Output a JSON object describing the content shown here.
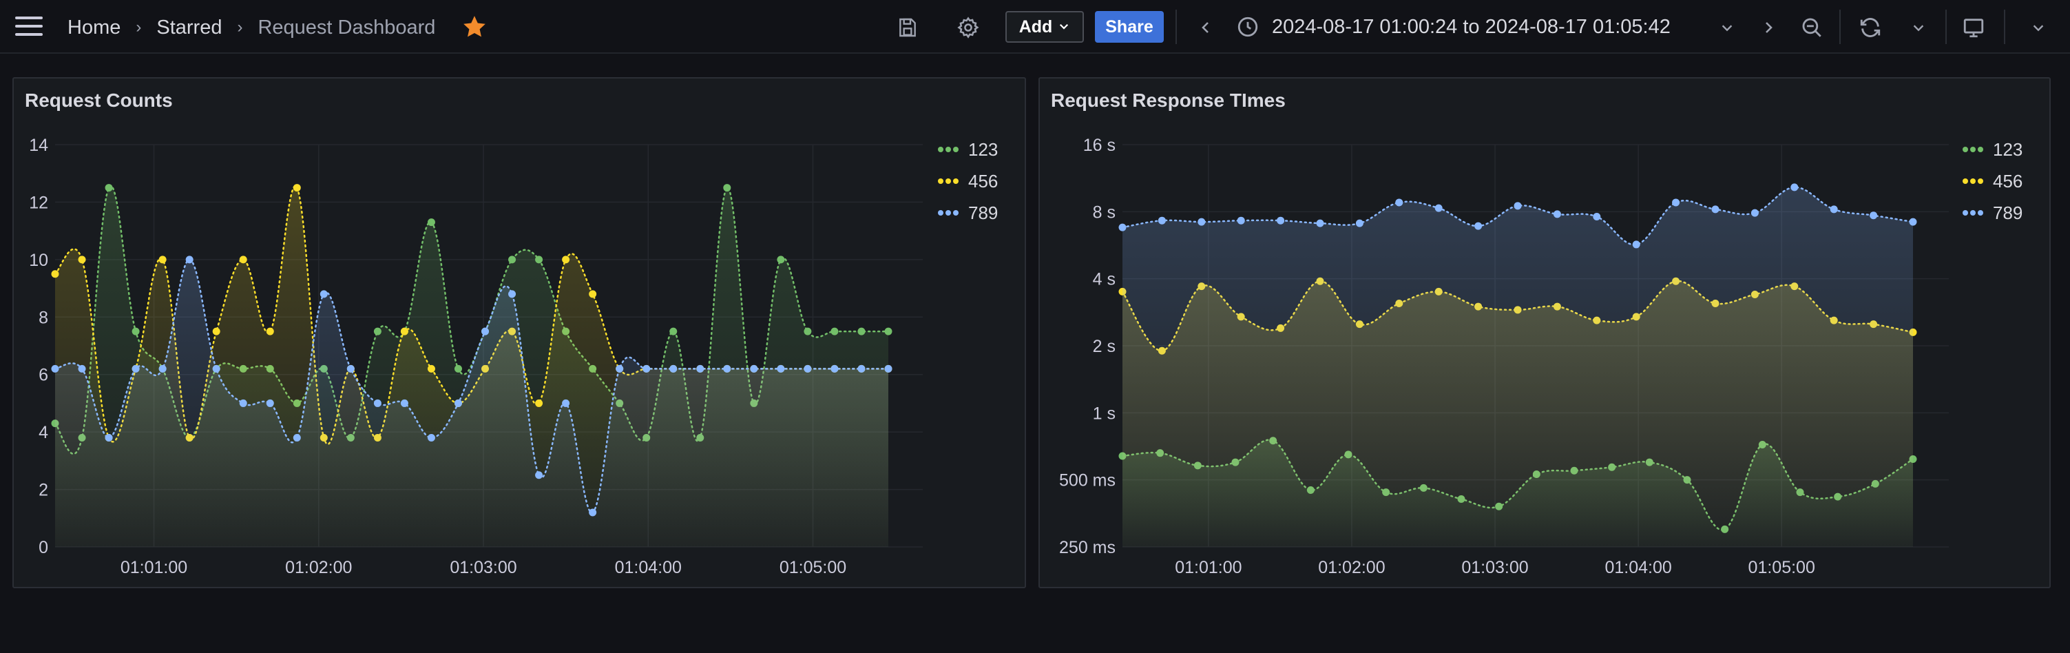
{
  "nav": {
    "menu_icon": "hamburger-menu-icon",
    "breadcrumbs": [
      "Home",
      "Starred",
      "Request Dashboard"
    ],
    "star_icon": "star-icon",
    "star_color": "#f28b2c"
  },
  "toolbar": {
    "save_icon": "save-icon",
    "settings_icon": "gear-icon",
    "add_label": "Add",
    "share_label": "Share",
    "time_range": "2024-08-17 01:00:24 to 2024-08-17 01:05:42",
    "zoom_out_icon": "zoom-out-icon",
    "refresh_icon": "refresh-icon",
    "tv_icon": "tv-mode-icon",
    "accent": "#3d71d9"
  },
  "panels": [
    {
      "title": "Request Counts",
      "legend": [
        "123",
        "456",
        "789"
      ]
    },
    {
      "title": "Request Response TImes",
      "legend": [
        "123",
        "456",
        "789"
      ]
    }
  ],
  "series_colors": {
    "123": "#73bf69",
    "456": "#fade2a",
    "789": "#8ab8ff"
  },
  "chart_data": [
    {
      "type": "line",
      "title": "Request Counts",
      "x": [
        "01:00:24",
        "01:00:30",
        "01:00:40",
        "01:00:50",
        "01:01:00",
        "01:01:10",
        "01:01:20",
        "01:01:30",
        "01:01:40",
        "01:01:50",
        "01:02:00",
        "01:02:10",
        "01:02:20",
        "01:02:30",
        "01:02:40",
        "01:02:50",
        "01:03:00",
        "01:03:10",
        "01:03:20",
        "01:03:30",
        "01:03:40",
        "01:03:50",
        "01:04:00",
        "01:04:10",
        "01:04:20",
        "01:04:30",
        "01:04:40",
        "01:04:50",
        "01:05:00",
        "01:05:10",
        "01:05:20",
        "01:05:30"
      ],
      "x_ticks": [
        "01:01:00",
        "01:02:00",
        "01:03:00",
        "01:04:00",
        "01:05:00"
      ],
      "y_ticks": [
        0,
        2,
        4,
        6,
        8,
        10,
        12,
        14
      ],
      "ylim": [
        0,
        14
      ],
      "series": [
        {
          "name": "123",
          "values": [
            4.3,
            3.8,
            12.5,
            7.5,
            6.2,
            3.8,
            6.2,
            6.2,
            6.2,
            5.0,
            6.2,
            3.8,
            7.5,
            7.5,
            11.3,
            6.2,
            7.5,
            10.0,
            10.0,
            7.5,
            6.2,
            5.0,
            3.8,
            7.5,
            3.8,
            12.5,
            5.0,
            10.0,
            7.5,
            7.5,
            7.5,
            7.5
          ]
        },
        {
          "name": "456",
          "values": [
            9.5,
            10.0,
            3.8,
            6.2,
            10.0,
            3.8,
            7.5,
            10.0,
            7.5,
            12.5,
            3.8,
            6.2,
            3.8,
            7.5,
            6.2,
            5.0,
            6.2,
            7.5,
            5.0,
            10.0,
            8.8,
            6.2,
            6.2,
            6.2,
            6.2,
            6.2,
            6.2,
            6.2,
            6.2,
            6.2,
            6.2,
            6.2
          ]
        },
        {
          "name": "789",
          "values": [
            6.2,
            6.2,
            3.8,
            6.2,
            6.2,
            10.0,
            6.2,
            5.0,
            5.0,
            3.8,
            8.8,
            6.2,
            5.0,
            5.0,
            3.8,
            5.0,
            7.5,
            8.8,
            2.5,
            5.0,
            1.2,
            6.2,
            6.2,
            6.2,
            6.2,
            6.2,
            6.2,
            6.2,
            6.2,
            6.2,
            6.2,
            6.2
          ]
        }
      ]
    },
    {
      "type": "area",
      "title": "Request Response TImes",
      "scale": "log2",
      "y_ticks": [
        "250 ms",
        "500 ms",
        "1 s",
        "2 s",
        "4 s",
        "8 s",
        "16 s"
      ],
      "x_ticks": [
        "01:01:00",
        "01:02:00",
        "01:03:00",
        "01:04:00",
        "01:05:00"
      ],
      "ylim_seconds": [
        0.25,
        16
      ],
      "series": [
        {
          "name": "123",
          "values_seconds": [
            0.64,
            0.66,
            0.58,
            0.6,
            0.75,
            0.45,
            0.65,
            0.44,
            0.46,
            0.41,
            0.38,
            0.53,
            0.55,
            0.57,
            0.6,
            0.5,
            0.3,
            0.72,
            0.44,
            0.42,
            0.48,
            0.62
          ]
        },
        {
          "name": "456",
          "values_seconds": [
            3.5,
            1.9,
            3.7,
            2.7,
            2.4,
            3.9,
            2.5,
            3.1,
            3.5,
            3.0,
            2.9,
            3.0,
            2.6,
            2.7,
            3.9,
            3.1,
            3.4,
            3.7,
            2.6,
            2.5,
            2.3
          ]
        },
        {
          "name": "789",
          "values_seconds": [
            6.8,
            7.3,
            7.2,
            7.3,
            7.3,
            7.1,
            7.1,
            8.8,
            8.3,
            6.9,
            8.5,
            7.8,
            7.6,
            5.7,
            8.8,
            8.2,
            7.9,
            10.3,
            8.2,
            7.7,
            7.2
          ]
        }
      ]
    }
  ]
}
